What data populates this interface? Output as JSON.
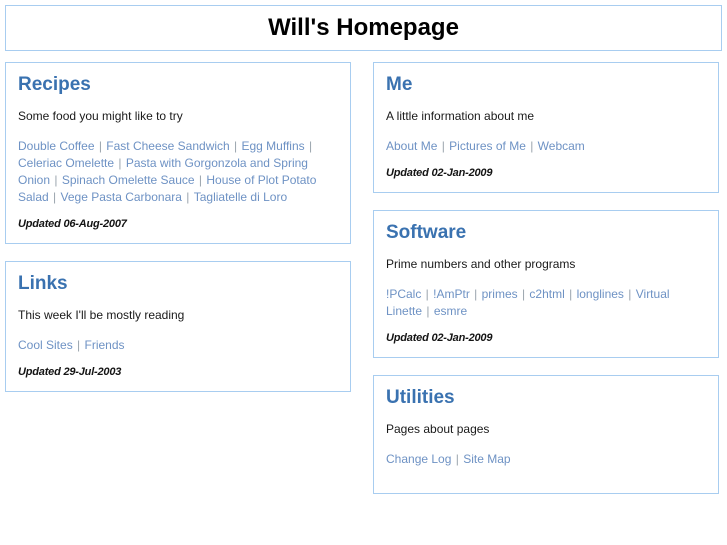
{
  "header": {
    "title": "Will's Homepage"
  },
  "theme": {
    "border_color": "#a8cdf0",
    "heading_color": "#3a72b0",
    "link_color": "#6e92c4",
    "separator_color": "#9aa4ad",
    "text_color": "#1a1a1a",
    "background": "#ffffff"
  },
  "separator": "|",
  "columns": [
    {
      "name": "left",
      "sections": [
        {
          "id": "recipes",
          "heading": "Recipes",
          "blurb": "Some food you might like to try",
          "links": [
            "Double Coffee",
            "Fast Cheese Sandwich",
            "Egg Muffins",
            "Celeriac Omelette",
            "Pasta with Gorgonzola and Spring Onion",
            "Spinach Omelette Sauce",
            "House of Plot Potato Salad",
            "Vege Pasta Carbonara",
            "Tagliatelle di Loro"
          ],
          "updated": "Updated 06-Aug-2007"
        },
        {
          "id": "links",
          "heading": "Links",
          "blurb": "This week I'll be mostly reading",
          "links": [
            "Cool Sites",
            "Friends"
          ],
          "updated": "Updated 29-Jul-2003"
        }
      ]
    },
    {
      "name": "right",
      "sections": [
        {
          "id": "me",
          "heading": "Me",
          "blurb": "A little information about me",
          "links": [
            "About Me",
            "Pictures of Me",
            "Webcam"
          ],
          "updated": "Updated 02-Jan-2009"
        },
        {
          "id": "software",
          "heading": "Software",
          "blurb": "Prime numbers and other programs",
          "links": [
            "!PCalc",
            "!AmPtr",
            "primes",
            "c2html",
            "longlines",
            "Virtual Linette",
            "esmre"
          ],
          "updated": "Updated 02-Jan-2009"
        },
        {
          "id": "utilities",
          "heading": "Utilities",
          "blurb": "Pages about pages",
          "links": [
            "Change Log",
            "Site Map"
          ],
          "updated": null
        }
      ]
    }
  ]
}
